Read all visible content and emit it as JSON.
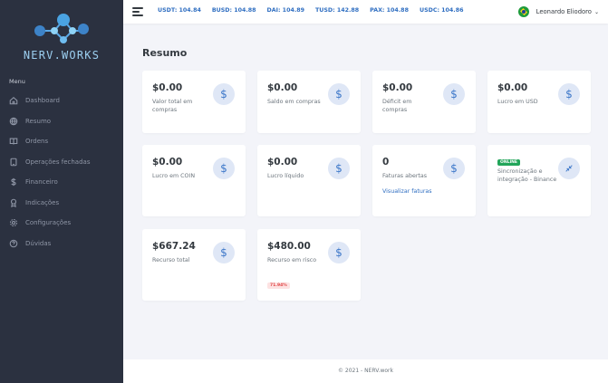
{
  "brand": {
    "logo_text": "NERV.WORKS"
  },
  "sidebar": {
    "menu_title": "Menu",
    "items": [
      {
        "label": "Dashboard",
        "icon": "home-icon"
      },
      {
        "label": "Resumo",
        "icon": "globe-icon"
      },
      {
        "label": "Ordens",
        "icon": "book-icon"
      },
      {
        "label": "Operações fechadas",
        "icon": "tablet-icon"
      },
      {
        "label": "Financeiro",
        "icon": "dollar-icon"
      },
      {
        "label": "Indicações",
        "icon": "award-icon"
      },
      {
        "label": "Configurações",
        "icon": "gear-icon"
      },
      {
        "label": "Dúvidas",
        "icon": "help-icon"
      }
    ]
  },
  "topbar": {
    "tickers": [
      "USDT: 104.84",
      "BUSD: 104.88",
      "DAI: 104.89",
      "TUSD: 142.88",
      "PAX: 104.88",
      "USDC: 104.86"
    ],
    "user_name": "Leonardo Eliodoro",
    "user_chevron": "⌄"
  },
  "main": {
    "title": "Resumo",
    "cards": [
      {
        "value": "$0.00",
        "label": "Valor total em compras",
        "icon": "dollar-icon"
      },
      {
        "value": "$0.00",
        "label": "Saldo em compras",
        "icon": "dollar-icon"
      },
      {
        "value": "$0.00",
        "label": "Déficit em compras",
        "icon": "dollar-icon"
      },
      {
        "value": "$0.00",
        "label": "Lucro em USD",
        "icon": "dollar-icon"
      },
      {
        "value": "$0.00",
        "label": "Lucro em COIN",
        "icon": "dollar-icon"
      },
      {
        "value": "$0.00",
        "label": "Lucro líquido",
        "icon": "dollar-icon"
      },
      {
        "value": "0",
        "label": "Faturas abertas",
        "link": "Visualizar faturas",
        "icon": "dollar-icon"
      },
      {
        "badge": "ONLINE",
        "label": "Sincronização e integração - Binance",
        "icon": "arrows-in-icon"
      },
      {
        "value": "$667.24",
        "label": "Recurso total",
        "icon": "dollar-icon"
      },
      {
        "value": "$480.00",
        "label": "Recurso em risco",
        "badge": "71.94%",
        "icon": "dollar-icon"
      }
    ]
  },
  "footer": {
    "text": "© 2021 - NERV.work"
  },
  "colors": {
    "sidebar": "#2b3140",
    "accent": "#2f6ec1",
    "online": "#22a55a",
    "risk": "#e04848"
  }
}
